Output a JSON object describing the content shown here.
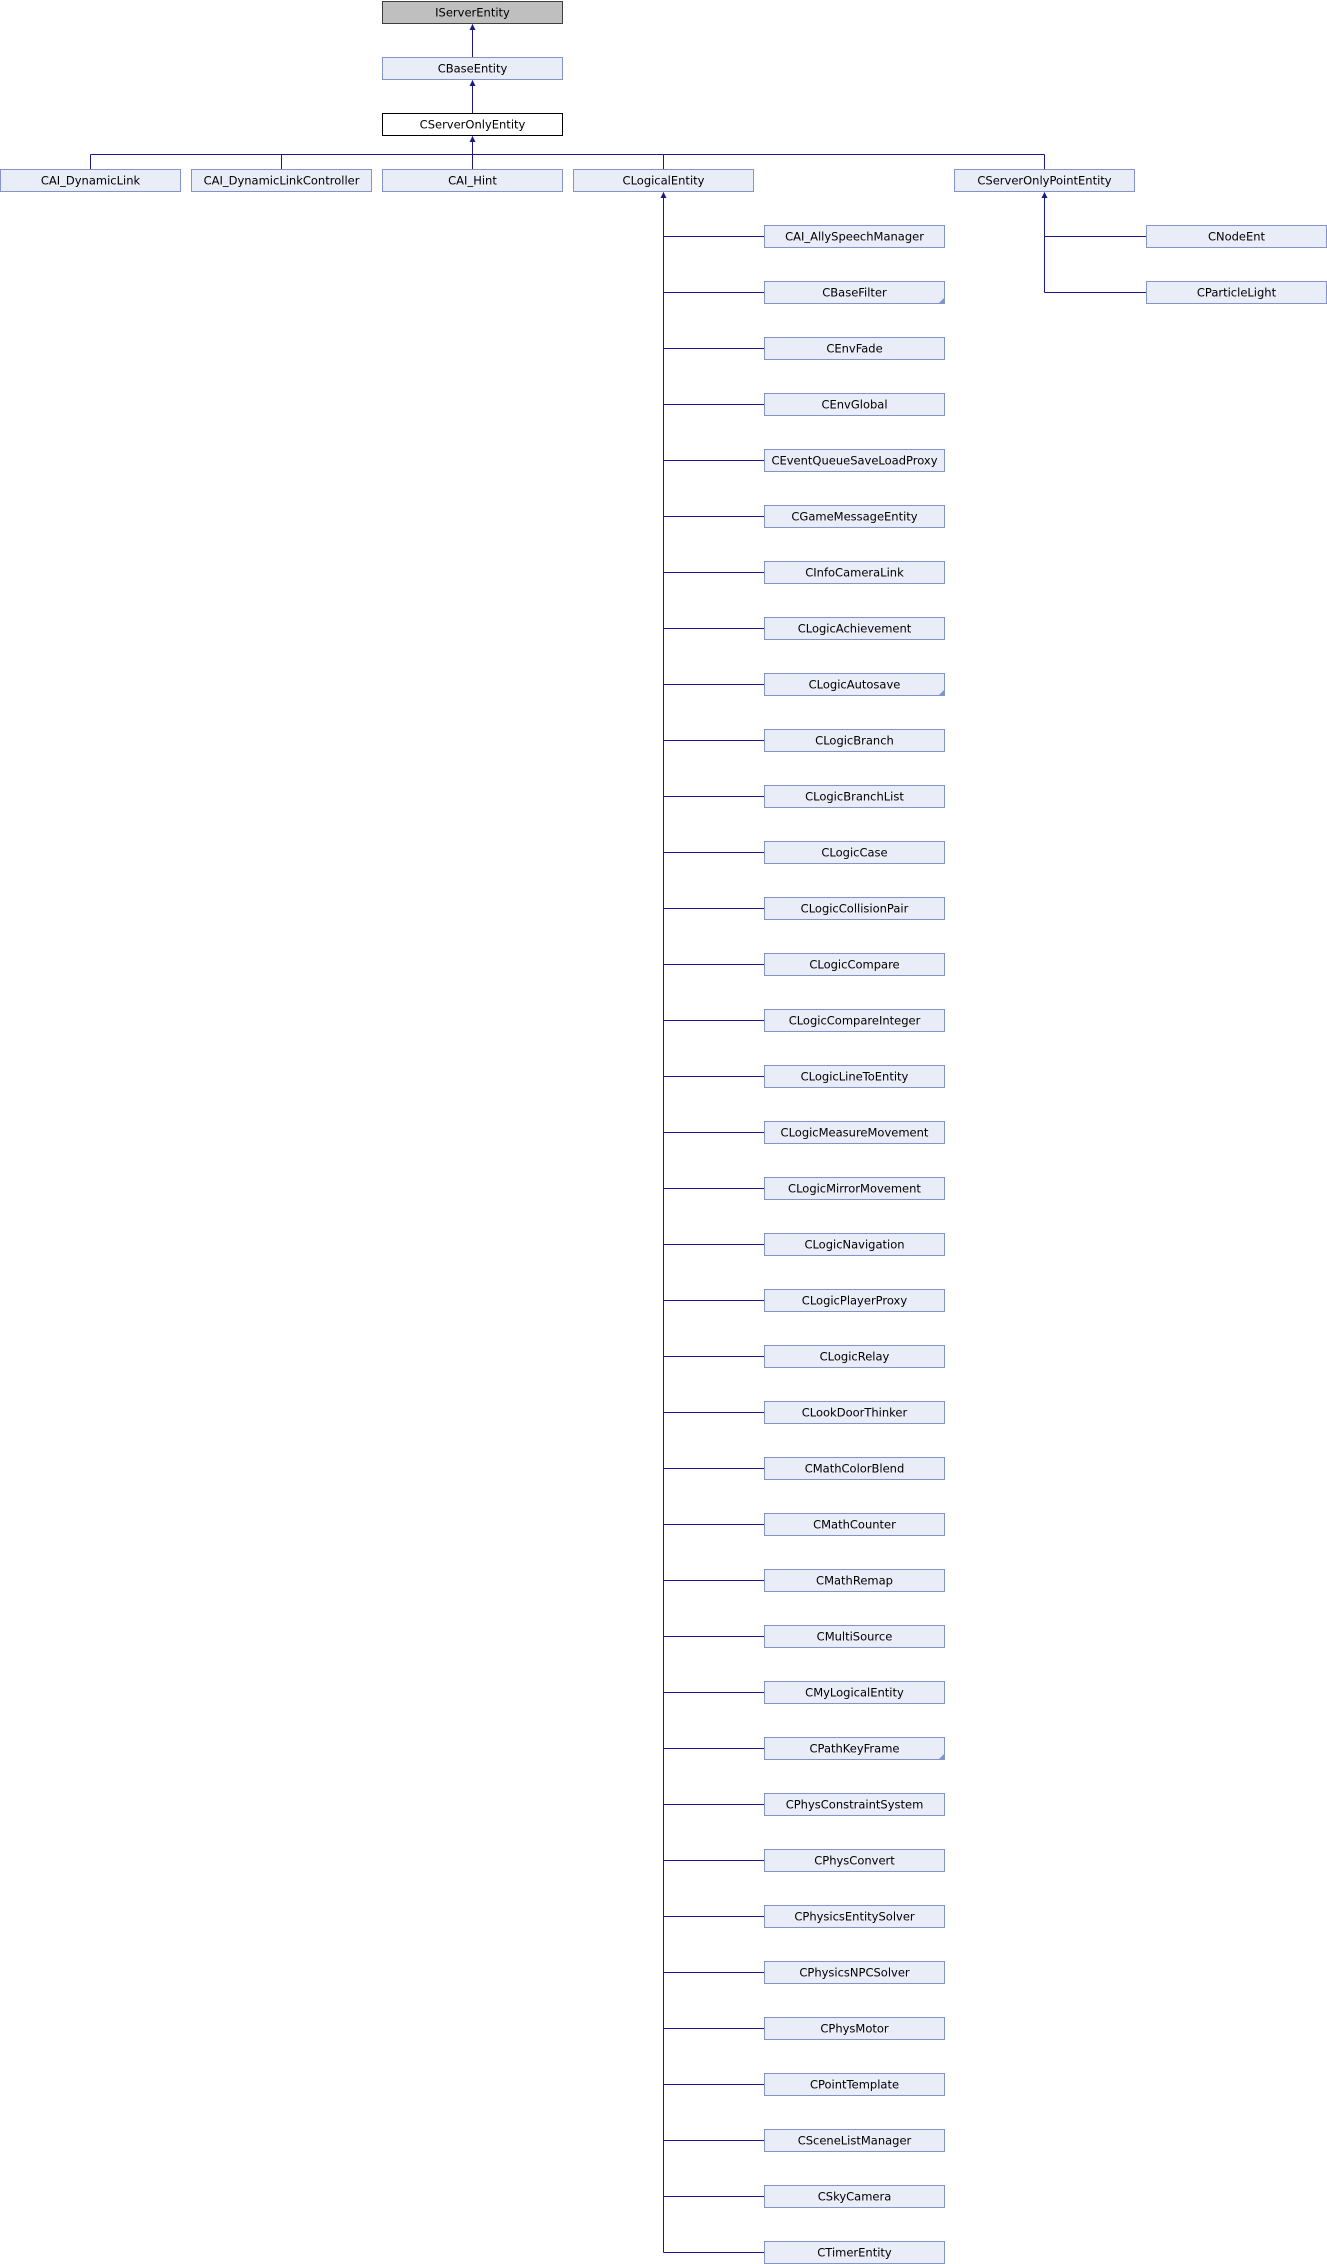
{
  "colors": {
    "connector": "#19198C",
    "node_fill": "#E8EDF7",
    "node_border": "#8394C9",
    "root_fill": "#BFBFBF",
    "root_border": "#3F3F3F",
    "focus_fill": "#FFFFFF",
    "focus_border": "#000000",
    "text": "#000000"
  },
  "nodes": {
    "root": {
      "label": "IServerEntity",
      "style": "root"
    },
    "base": {
      "label": "CBaseEntity",
      "style": "normal"
    },
    "serveronly": {
      "label": "CServerOnlyEntity",
      "style": "focus"
    },
    "dynamiclink": {
      "label": "CAI_DynamicLink",
      "style": "normal"
    },
    "dynamiclinkcontroller": {
      "label": "CAI_DynamicLinkController",
      "style": "normal"
    },
    "hint": {
      "label": "CAI_Hint",
      "style": "normal"
    },
    "logical": {
      "label": "CLogicalEntity",
      "style": "normal"
    },
    "pointentity": {
      "label": "CServerOnlyPointEntity",
      "style": "normal"
    }
  },
  "logical_children": [
    {
      "label": "CAI_AllySpeechManager",
      "more": false
    },
    {
      "label": "CBaseFilter",
      "more": true
    },
    {
      "label": "CEnvFade",
      "more": false
    },
    {
      "label": "CEnvGlobal",
      "more": false
    },
    {
      "label": "CEventQueueSaveLoadProxy",
      "more": false
    },
    {
      "label": "CGameMessageEntity",
      "more": false
    },
    {
      "label": "CInfoCameraLink",
      "more": false
    },
    {
      "label": "CLogicAchievement",
      "more": false
    },
    {
      "label": "CLogicAutosave",
      "more": true
    },
    {
      "label": "CLogicBranch",
      "more": false
    },
    {
      "label": "CLogicBranchList",
      "more": false
    },
    {
      "label": "CLogicCase",
      "more": false
    },
    {
      "label": "CLogicCollisionPair",
      "more": false
    },
    {
      "label": "CLogicCompare",
      "more": false
    },
    {
      "label": "CLogicCompareInteger",
      "more": false
    },
    {
      "label": "CLogicLineToEntity",
      "more": false
    },
    {
      "label": "CLogicMeasureMovement",
      "more": false
    },
    {
      "label": "CLogicMirrorMovement",
      "more": false
    },
    {
      "label": "CLogicNavigation",
      "more": false
    },
    {
      "label": "CLogicPlayerProxy",
      "more": false
    },
    {
      "label": "CLogicRelay",
      "more": false
    },
    {
      "label": "CLookDoorThinker",
      "more": false
    },
    {
      "label": "CMathColorBlend",
      "more": false
    },
    {
      "label": "CMathCounter",
      "more": false
    },
    {
      "label": "CMathRemap",
      "more": false
    },
    {
      "label": "CMultiSource",
      "more": false
    },
    {
      "label": "CMyLogicalEntity",
      "more": false
    },
    {
      "label": "CPathKeyFrame",
      "more": true
    },
    {
      "label": "CPhysConstraintSystem",
      "more": false
    },
    {
      "label": "CPhysConvert",
      "more": false
    },
    {
      "label": "CPhysicsEntitySolver",
      "more": false
    },
    {
      "label": "CPhysicsNPCSolver",
      "more": false
    },
    {
      "label": "CPhysMotor",
      "more": false
    },
    {
      "label": "CPointTemplate",
      "more": false
    },
    {
      "label": "CSceneListManager",
      "more": false
    },
    {
      "label": "CSkyCamera",
      "more": false
    },
    {
      "label": "CTimerEntity",
      "more": false
    }
  ],
  "point_children": [
    {
      "label": "CNodeEnt",
      "more": false
    },
    {
      "label": "CParticleLight",
      "more": false
    }
  ]
}
